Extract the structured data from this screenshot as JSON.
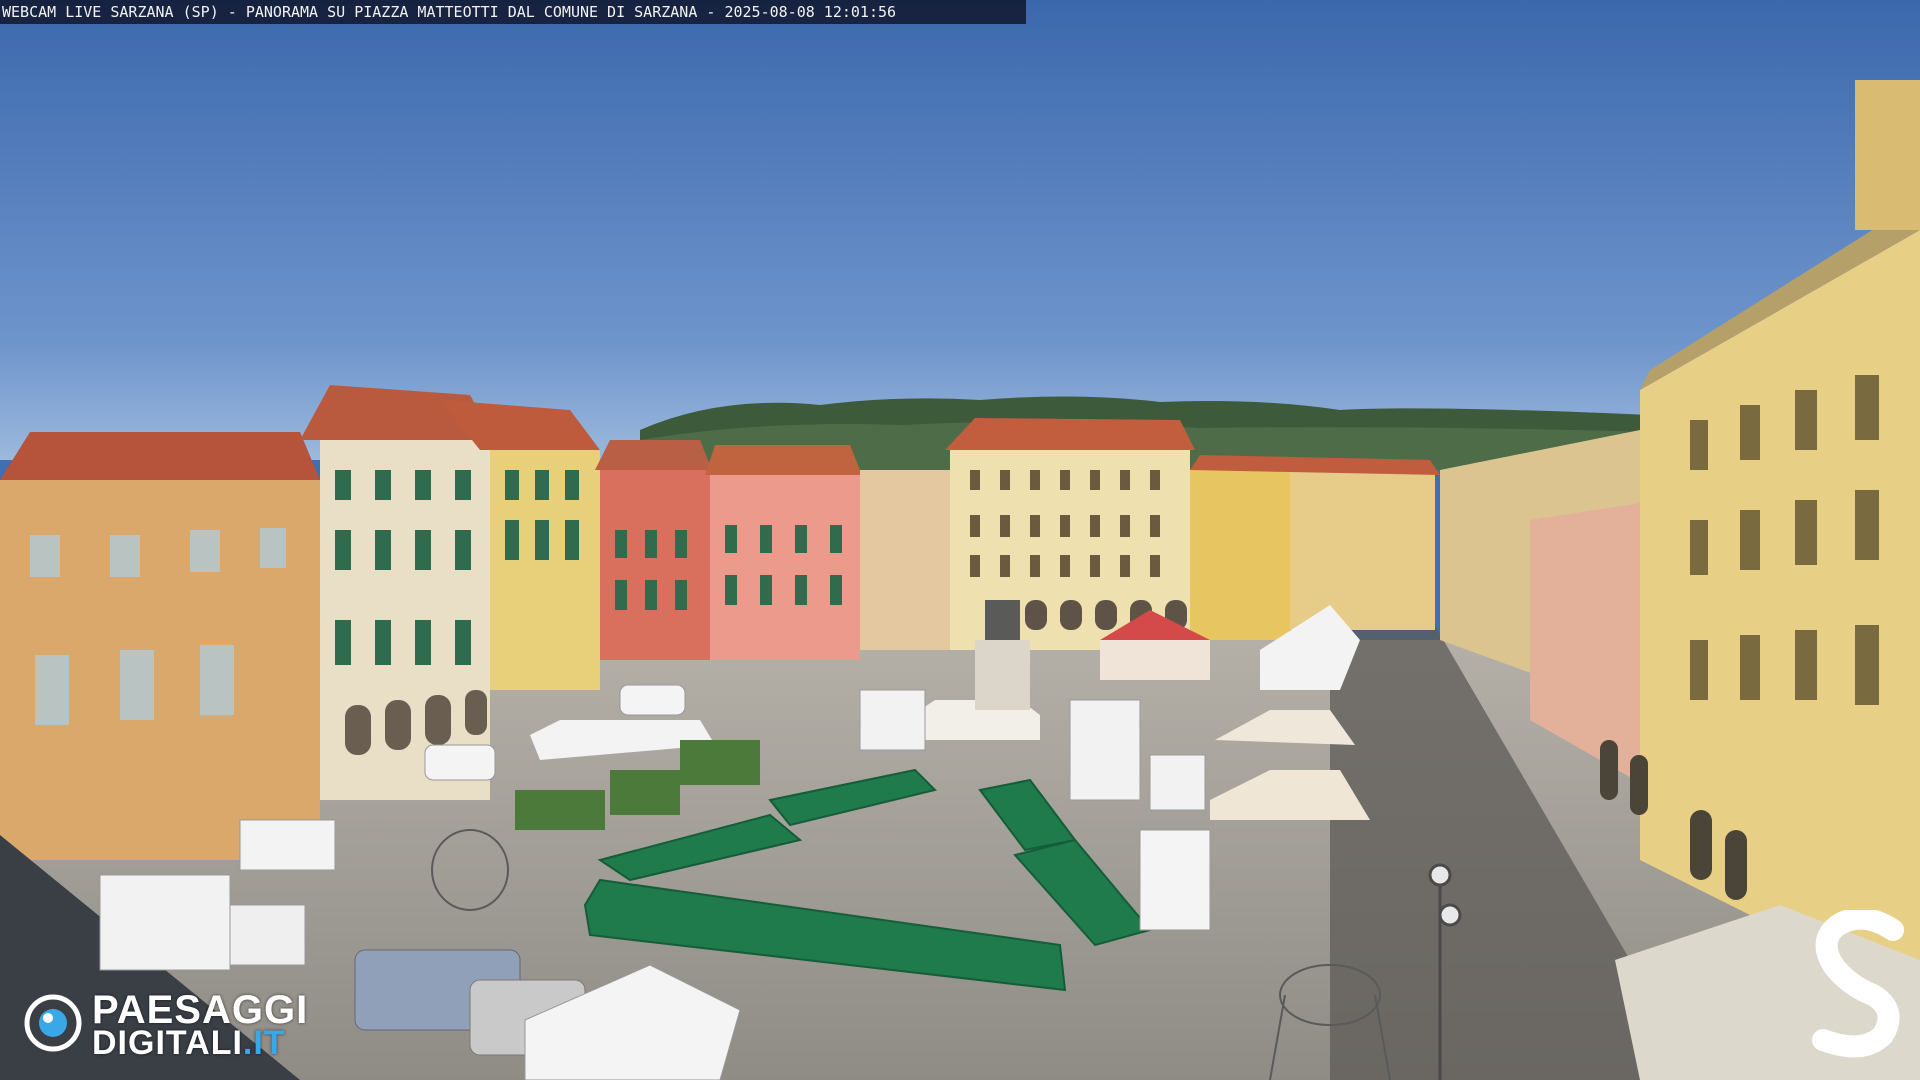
{
  "caption": {
    "text": "WEBCAM LIVE SARZANA (SP) - PANORAMA SU PIAZZA MATTEOTTI DAL COMUNE DI SARZANA - 2025-08-08  12:01:56"
  },
  "logo": {
    "line1": "PAESAGGI",
    "line2_main": "DIGITALI",
    "line2_accent": ".IT"
  },
  "colors": {
    "sky": "#3f6fb2",
    "sky_horizon": "#8fb0d8",
    "pavement": "#a9a6a0",
    "awning_green": "#1f7a4c",
    "logo_accent": "#3aa8e6"
  },
  "icons": {
    "logo_mark": "eye-lens-icon",
    "brand_mark": "letter-s-logo-icon"
  }
}
